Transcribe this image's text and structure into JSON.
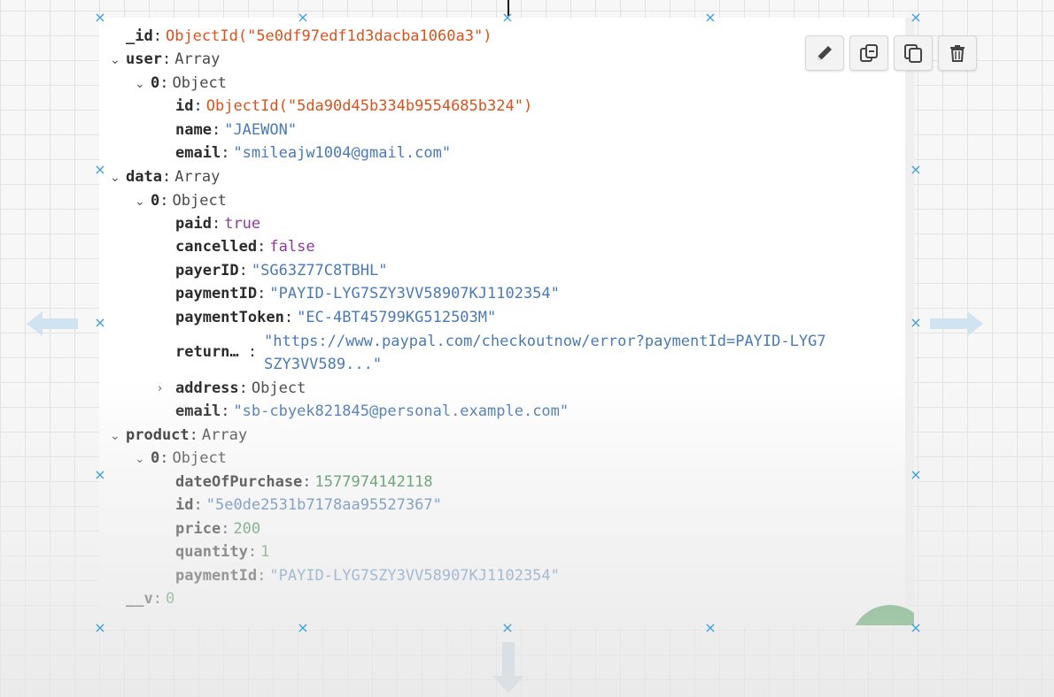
{
  "document": {
    "id_field": {
      "key": "_id",
      "value": "ObjectId(\"5e0df97edf1d3dacba1060a3\")"
    },
    "user": {
      "key": "user",
      "type": "Array",
      "item": {
        "index": "0",
        "type": "Object",
        "id": {
          "key": "id",
          "value": "ObjectId(\"5da90d45b334b9554685b324\")"
        },
        "name": {
          "key": "name",
          "value": "\"JAEWON\""
        },
        "email": {
          "key": "email",
          "value": "\"smileajw1004@gmail.com\""
        }
      }
    },
    "data": {
      "key": "data",
      "type": "Array",
      "item": {
        "index": "0",
        "type": "Object",
        "paid": {
          "key": "paid",
          "value": "true"
        },
        "cancelled": {
          "key": "cancelled",
          "value": "false"
        },
        "payerID": {
          "key": "payerID",
          "value": "\"SG63Z77C8TBHL\""
        },
        "paymentID": {
          "key": "paymentID",
          "value": "\"PAYID-LYG7SZY3VV58907KJ1102354\""
        },
        "paymentToken": {
          "key": "paymentToken",
          "value": "\"EC-4BT45799KG512503M\""
        },
        "returnUrl": {
          "key": "return…",
          "value_line1": "\"https://www.paypal.com/checkoutnow/error?paymentId=PAYID-LYG7",
          "value_line2": "SZY3VV589...\""
        },
        "address": {
          "key": "address",
          "type": "Object"
        },
        "email": {
          "key": "email",
          "value": "\"sb-cbyek821845@personal.example.com\""
        }
      }
    },
    "product": {
      "key": "product",
      "type": "Array",
      "item": {
        "index": "0",
        "type": "Object",
        "dateOfPurchase": {
          "key": "dateOfPurchase",
          "value": "1577974142118"
        },
        "id": {
          "key": "id",
          "value": "\"5e0de2531b7178aa95527367\""
        },
        "price": {
          "key": "price",
          "value": "200"
        },
        "quantity": {
          "key": "quantity",
          "value": "1"
        },
        "paymentId": {
          "key": "paymentId",
          "value": "\"PAYID-LYG7SZY3VV58907KJ1102354\""
        }
      }
    },
    "v_field": {
      "key": "__v",
      "value": "0"
    }
  },
  "toolbar": {
    "edit_icon": "pencil-icon",
    "clone_icon": "clone-icon",
    "copy_icon": "copy-icon",
    "delete_icon": "trash-icon"
  },
  "colors": {
    "objectid": "#d9531e",
    "string": "#4a7ab5",
    "boolean": "#8b3a9a",
    "number": "#3a8a4a",
    "handle": "#3aa0dc"
  }
}
